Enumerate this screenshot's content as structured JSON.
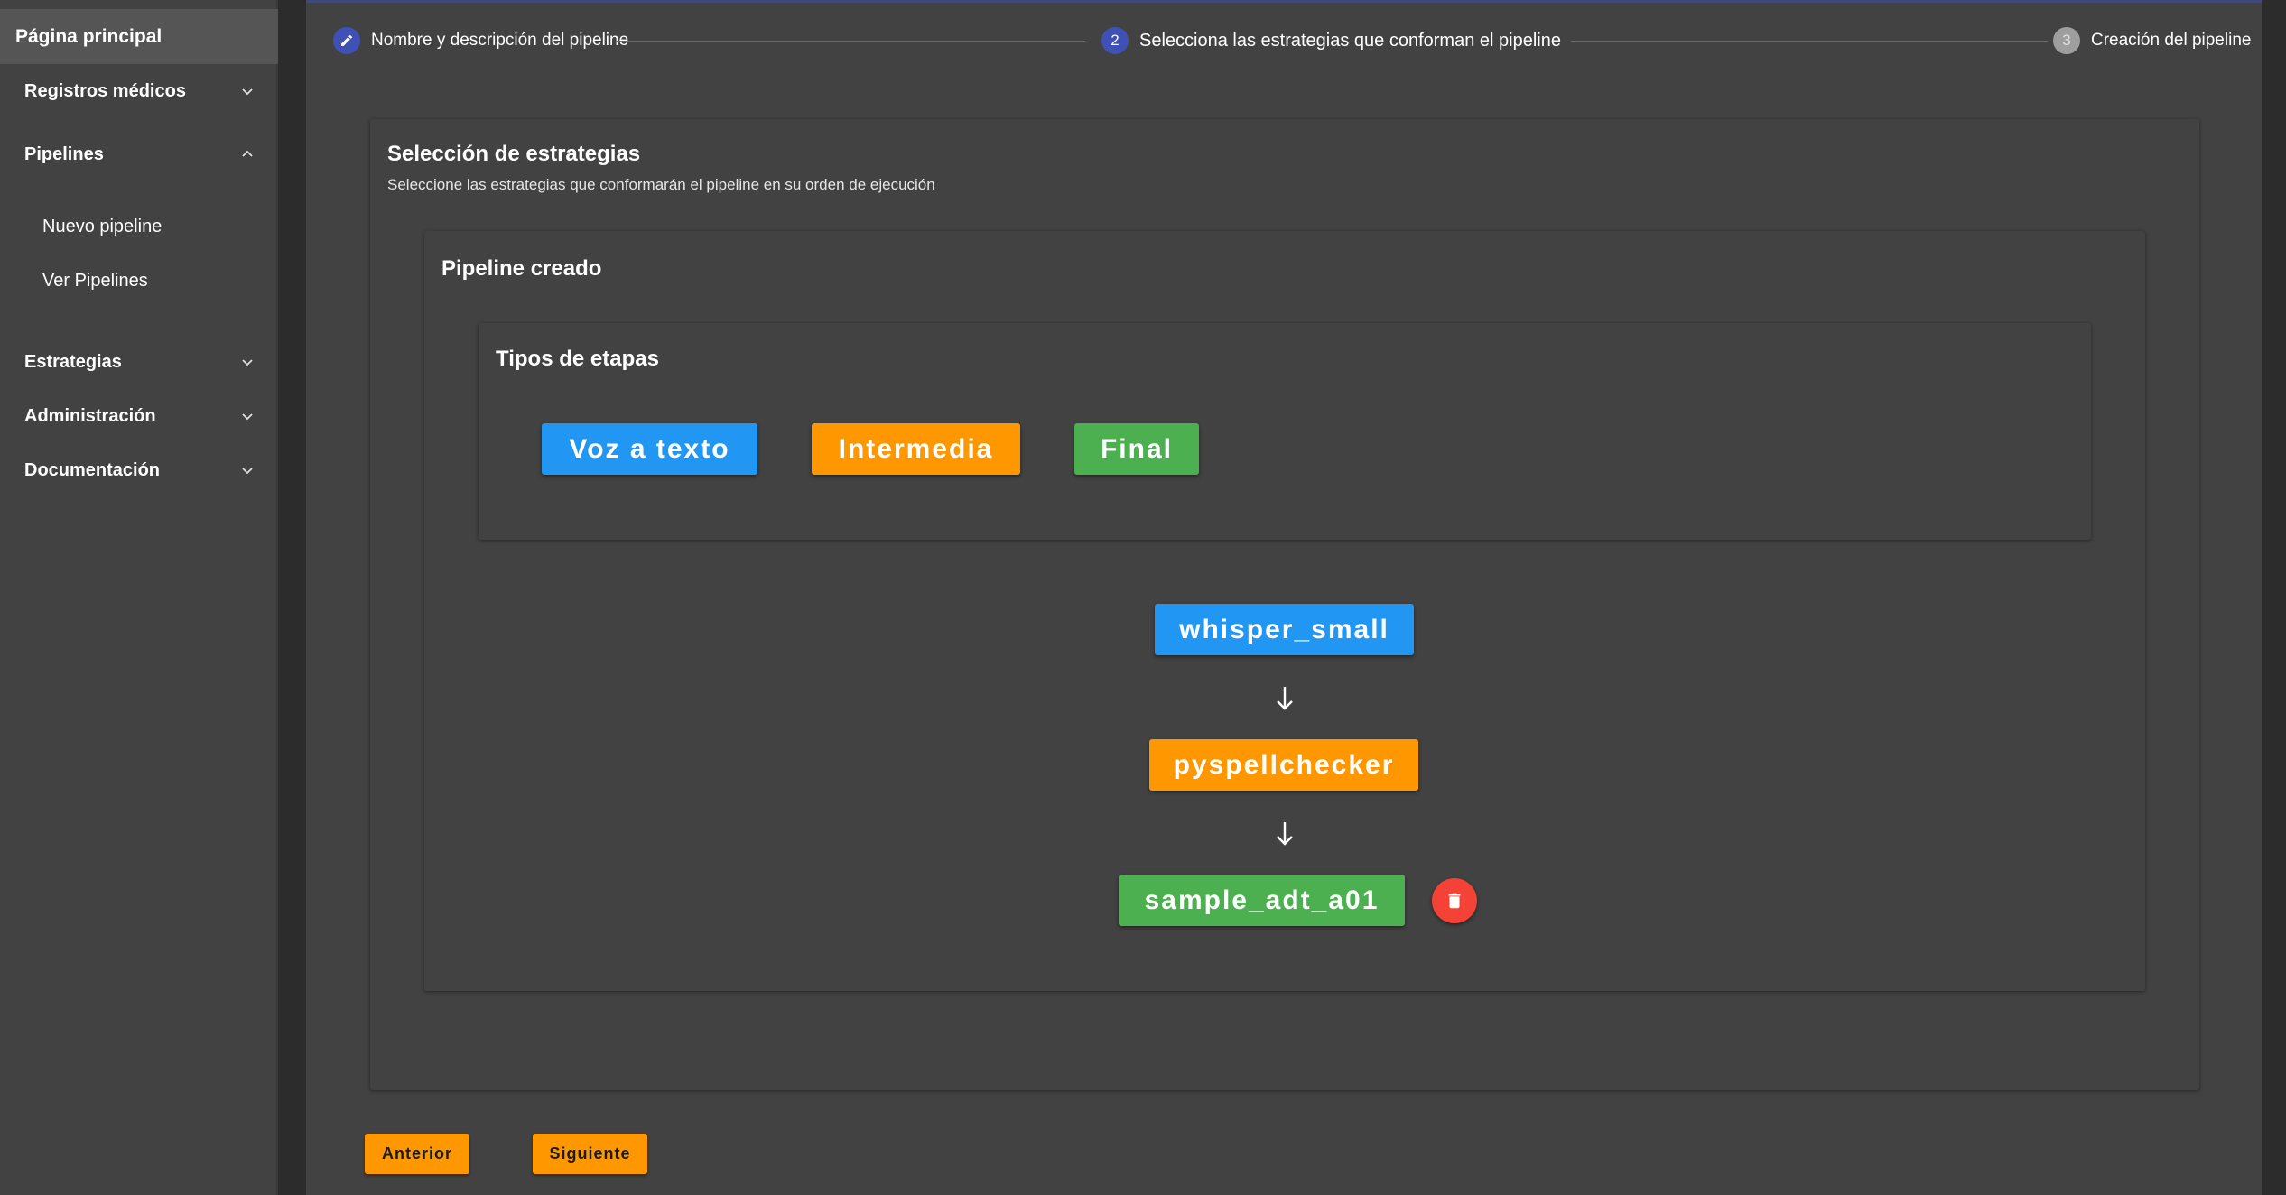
{
  "sidebar": {
    "home": "Página principal",
    "items": [
      {
        "label": "Registros médicos",
        "expanded": false
      },
      {
        "label": "Pipelines",
        "expanded": true
      },
      {
        "label": "Estrategias",
        "expanded": false
      },
      {
        "label": "Administración",
        "expanded": false
      },
      {
        "label": "Documentación",
        "expanded": false
      }
    ],
    "subitems": [
      "Nuevo pipeline",
      "Ver Pipelines"
    ]
  },
  "stepper": {
    "steps": [
      {
        "number": "",
        "label": "Nombre y descripción del pipeline",
        "state": "completed"
      },
      {
        "number": "2",
        "label": "Selecciona las estrategias que conforman el pipeline",
        "state": "active"
      },
      {
        "number": "3",
        "label": "Creación del pipeline",
        "state": "pending"
      }
    ]
  },
  "main": {
    "title": "Selección de estrategias",
    "subtitle": "Seleccione las estrategias que conformarán el pipeline en su orden de ejecución",
    "pipeline_title": "Pipeline creado",
    "types_title": "Tipos de etapas",
    "types": [
      {
        "label": "Voz a texto",
        "color": "#2196f3"
      },
      {
        "label": "Intermedia",
        "color": "#ff9800"
      },
      {
        "label": "Final",
        "color": "#4caf50"
      }
    ],
    "pipeline_steps": [
      {
        "label": "whisper_small",
        "color": "#2196f3"
      },
      {
        "label": "pyspellchecker",
        "color": "#ff9800"
      },
      {
        "label": "sample_adt_a01",
        "color": "#4caf50"
      }
    ],
    "arrow_glyph": "down-arrow-icon",
    "delete_icon": "trash-icon"
  },
  "footer": {
    "back_label": "Anterior",
    "next_label": "Siguiente"
  },
  "colors": {
    "accent": "#3f51b5",
    "warn": "#f44336"
  }
}
